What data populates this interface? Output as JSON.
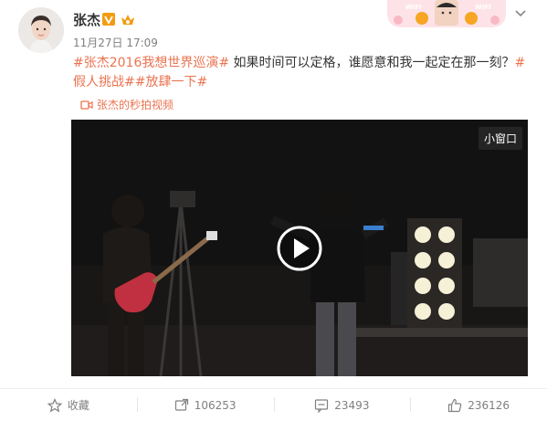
{
  "post": {
    "author": "张杰",
    "time": "11月27日 17:09",
    "text_parts": [
      {
        "text": "#张杰2016我想世界巡演#",
        "tag": true
      },
      {
        "text": " 如果时间可以定格，谁愿意和我一起定在那一刻？",
        "tag": false
      },
      {
        "text": "#假人挑战#",
        "tag": true
      },
      {
        "text": "#放肆一下#",
        "tag": true
      }
    ],
    "source_link": "张杰的秒拍视频"
  },
  "video": {
    "mini_window_label": "小窗口"
  },
  "actions": {
    "favorite_label": "收藏",
    "repost_count": "106253",
    "comment_count": "23493",
    "like_count": "236126"
  },
  "banner": {
    "text_left": "WIFI",
    "text_right": "WIFI"
  },
  "icons": [
    "chevron-down-icon",
    "verified-icon",
    "vip-icon",
    "video-icon",
    "star-icon",
    "repost-icon",
    "comment-icon",
    "like-icon",
    "play-icon"
  ],
  "colors": {
    "accent": "#eb7350",
    "verified": "#f39c12",
    "meta": "#808080"
  }
}
